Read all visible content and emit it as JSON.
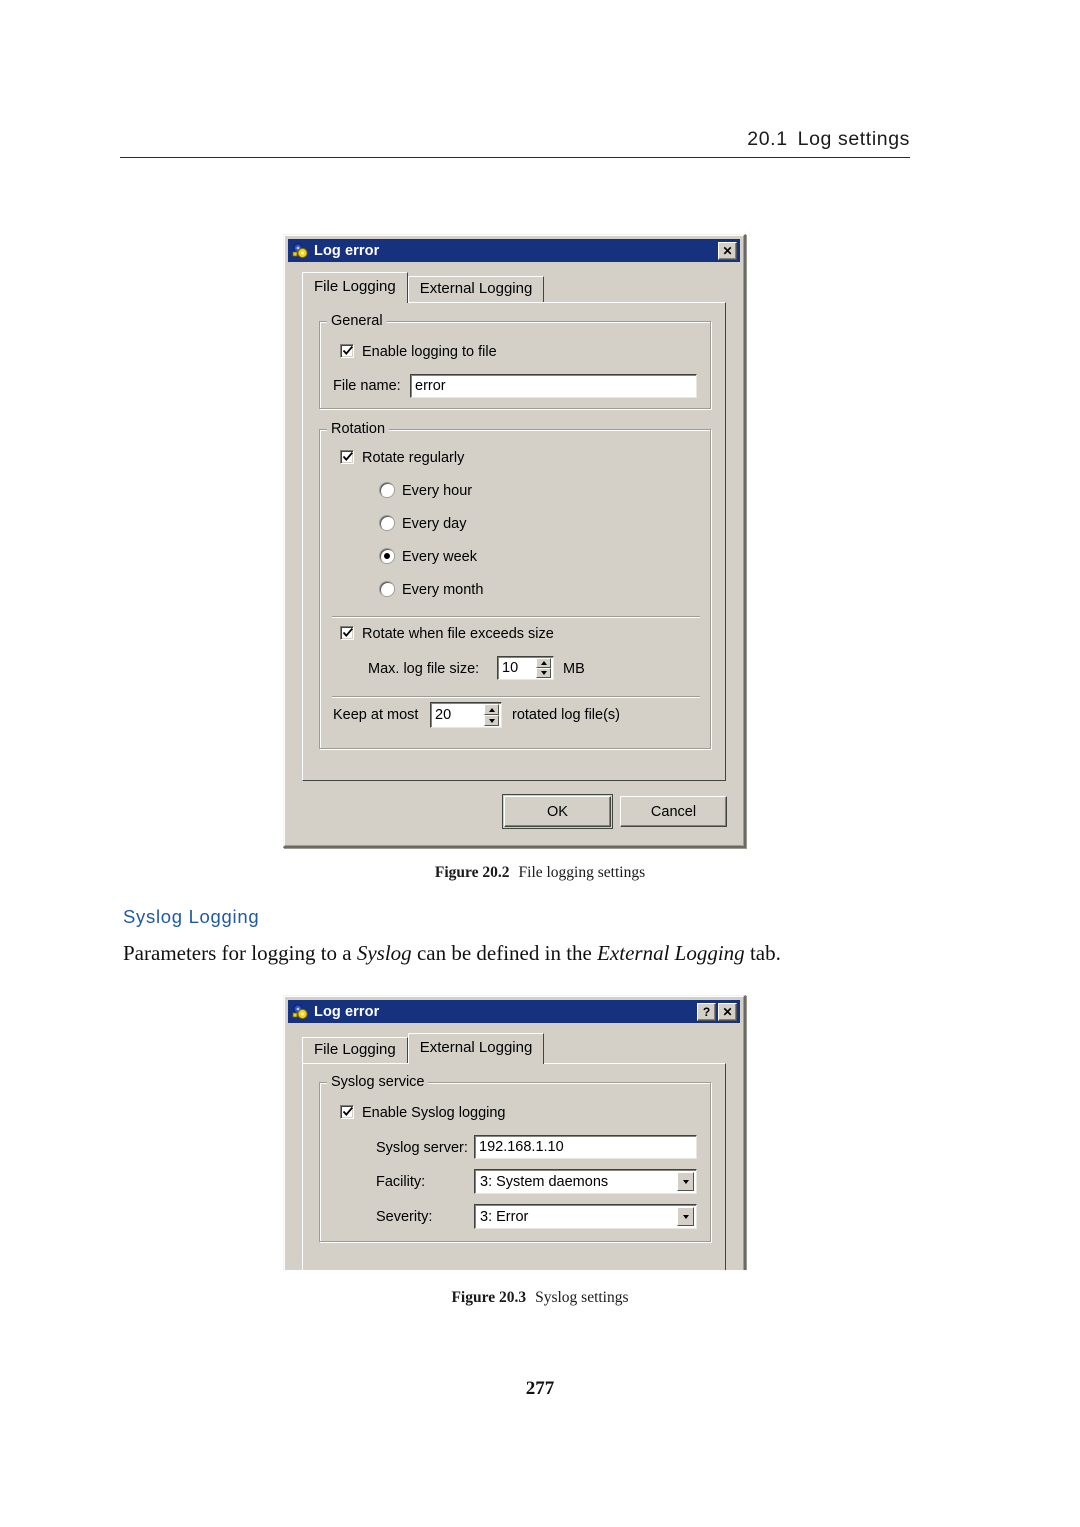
{
  "page": {
    "running_header_number": "20.1",
    "running_header_title": "Log settings",
    "page_number": "277"
  },
  "section": {
    "heading": "Syslog Logging",
    "paragraph_part1": "Parameters for logging to a ",
    "paragraph_em1": "Syslog",
    "paragraph_part2": " can be defined in the ",
    "paragraph_em2": "External Logging",
    "paragraph_part3": " tab."
  },
  "figure_2": {
    "number": "Figure 20.2",
    "caption": "File logging settings"
  },
  "figure_3": {
    "number": "Figure 20.3",
    "caption": "Syslog settings"
  },
  "dialog_file_logging": {
    "title": "Log error",
    "icon": "app-gears-icon",
    "close_label": "✕",
    "tabs": [
      {
        "label": "File Logging",
        "active": true
      },
      {
        "label": "External Logging",
        "active": false
      }
    ],
    "general_group": {
      "title": "General",
      "enable_logging_label": "Enable logging to file",
      "enable_logging_checked": true,
      "file_name_label": "File name:",
      "file_name_value": "error"
    },
    "rotation_group": {
      "title": "Rotation",
      "rotate_regularly_label": "Rotate regularly",
      "rotate_regularly_checked": true,
      "interval_options": [
        {
          "label": "Every hour",
          "selected": false
        },
        {
          "label": "Every day",
          "selected": false
        },
        {
          "label": "Every week",
          "selected": true
        },
        {
          "label": "Every month",
          "selected": false
        }
      ],
      "rotate_size_label": "Rotate when file exceeds size",
      "rotate_size_checked": true,
      "max_size_label": "Max. log file size:",
      "max_size_value": "10",
      "max_size_unit": "MB",
      "keep_prefix_label": "Keep at most",
      "keep_value": "20",
      "keep_suffix_label": "rotated log file(s)"
    },
    "buttons": {
      "ok_label": "OK",
      "cancel_label": "Cancel"
    }
  },
  "dialog_external_logging": {
    "title": "Log error",
    "icon": "app-gears-icon",
    "help_label": "?",
    "close_label": "✕",
    "tabs": [
      {
        "label": "File Logging",
        "active": false
      },
      {
        "label": "External Logging",
        "active": true
      }
    ],
    "syslog_group": {
      "title": "Syslog service",
      "enable_syslog_label": "Enable Syslog logging",
      "enable_syslog_checked": true,
      "server_label": "Syslog server:",
      "server_value": "192.168.1.10",
      "facility_label": "Facility:",
      "facility_value": "3: System daemons",
      "severity_label": "Severity:",
      "severity_value": "3: Error"
    }
  },
  "colors": {
    "titlebar": "#16327e",
    "dialog_face": "#d4d0c8",
    "heading_blue": "#1f5aa6"
  }
}
